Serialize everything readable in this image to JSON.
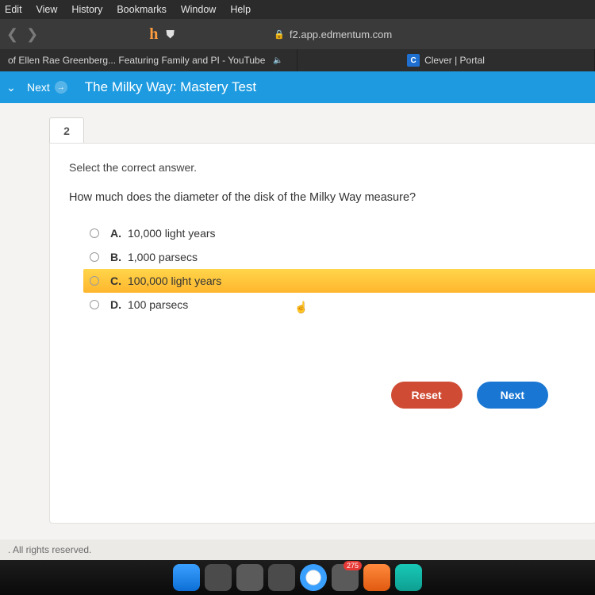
{
  "menubar": {
    "items": [
      "Edit",
      "View",
      "History",
      "Bookmarks",
      "Window",
      "Help"
    ]
  },
  "toolbar": {
    "url": "f2.app.edmentum.com"
  },
  "tabs": [
    {
      "title": "of Ellen Rae Greenberg... Featuring Family and PI - YouTube"
    },
    {
      "title": "Clever | Portal"
    }
  ],
  "bluebar": {
    "next": "Next",
    "title": "The Milky Way: Mastery Test"
  },
  "question": {
    "number": "2",
    "instruction": "Select the correct answer.",
    "stem": "How much does the diameter of the disk of the Milky Way measure?",
    "choices": [
      {
        "letter": "A.",
        "text": "10,000 light years"
      },
      {
        "letter": "B.",
        "text": "1,000 parsecs"
      },
      {
        "letter": "C.",
        "text": "100,000 light years"
      },
      {
        "letter": "D.",
        "text": "100 parsecs"
      }
    ],
    "hovered_index": 2
  },
  "buttons": {
    "reset": "Reset",
    "next": "Next"
  },
  "footer": {
    "text": ". All rights reserved."
  },
  "dock": {
    "badge": "275"
  }
}
